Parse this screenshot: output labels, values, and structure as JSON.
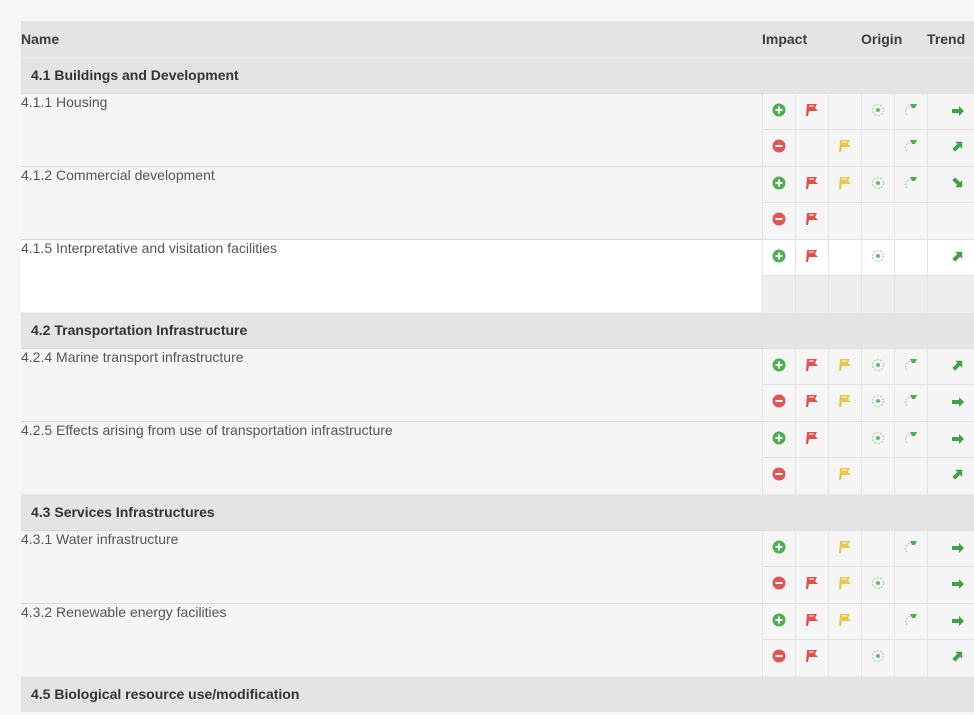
{
  "header": {
    "name": "Name",
    "impact": "Impact",
    "origin": "Origin",
    "trend": "Trend"
  },
  "icon_legend": {
    "plus": "green plus circle icon",
    "minus": "red minus circle icon",
    "flag-red": "red flag icon",
    "flag-yellow": "yellow flag icon",
    "target": "green target icon",
    "hand": "green hand arrow icon",
    "arrow-right": "green right arrow",
    "arrow-up": "green up-right arrow",
    "arrow-down": "green down-right arrow"
  },
  "categories": [
    {
      "label": "4.1 Buildings and Development"
    },
    {
      "label": "4.2 Transportation Infrastructure"
    },
    {
      "label": "4.3 Services Infrastructures"
    },
    {
      "label": "4.5 Biological resource use/modification"
    }
  ],
  "threats": [
    {
      "name": "4.1.1 Housing",
      "row_style": "grey",
      "positive": [
        "plus",
        "flag-red",
        "",
        "target",
        "hand",
        "arrow-right"
      ],
      "negative": [
        "minus",
        "",
        "flag-yellow",
        "",
        "hand",
        "arrow-up"
      ]
    },
    {
      "name": "4.1.2 Commercial development",
      "row_style": "grey",
      "positive": [
        "plus",
        "flag-red",
        "flag-yellow",
        "target",
        "hand",
        "arrow-down"
      ],
      "negative": [
        "minus",
        "flag-red",
        "",
        "",
        "",
        ""
      ]
    },
    {
      "name": "4.1.5 Interpretative and visitation facilities",
      "row_style": "white",
      "positive": [
        "plus",
        "flag-red",
        "",
        "target",
        "",
        "arrow-up"
      ],
      "negative": [
        "",
        "",
        "",
        "",
        "",
        ""
      ]
    },
    {
      "name": "4.2.4 Marine transport infrastructure",
      "row_style": "grey",
      "positive": [
        "plus",
        "flag-red",
        "flag-yellow",
        "target",
        "hand",
        "arrow-up"
      ],
      "negative": [
        "minus",
        "flag-red",
        "flag-yellow",
        "target",
        "hand",
        "arrow-right"
      ]
    },
    {
      "name": "4.2.5 Effects arising from use of transportation infrastructure",
      "row_style": "grey",
      "positive": [
        "plus",
        "flag-red",
        "",
        "target",
        "hand",
        "arrow-right"
      ],
      "negative": [
        "minus",
        "",
        "flag-yellow",
        "",
        "",
        "arrow-up"
      ]
    },
    {
      "name": "4.3.1 Water infrastructure",
      "row_style": "grey",
      "positive": [
        "plus",
        "",
        "flag-yellow",
        "",
        "hand",
        "arrow-right"
      ],
      "negative": [
        "minus",
        "flag-red",
        "flag-yellow",
        "target",
        "",
        "arrow-right"
      ]
    },
    {
      "name": "4.3.2 Renewable energy facilities",
      "row_style": "grey",
      "positive": [
        "plus",
        "flag-red",
        "flag-yellow",
        "",
        "hand",
        "arrow-right"
      ],
      "negative": [
        "minus",
        "flag-red",
        "",
        "target",
        "",
        "arrow-up"
      ]
    }
  ]
}
